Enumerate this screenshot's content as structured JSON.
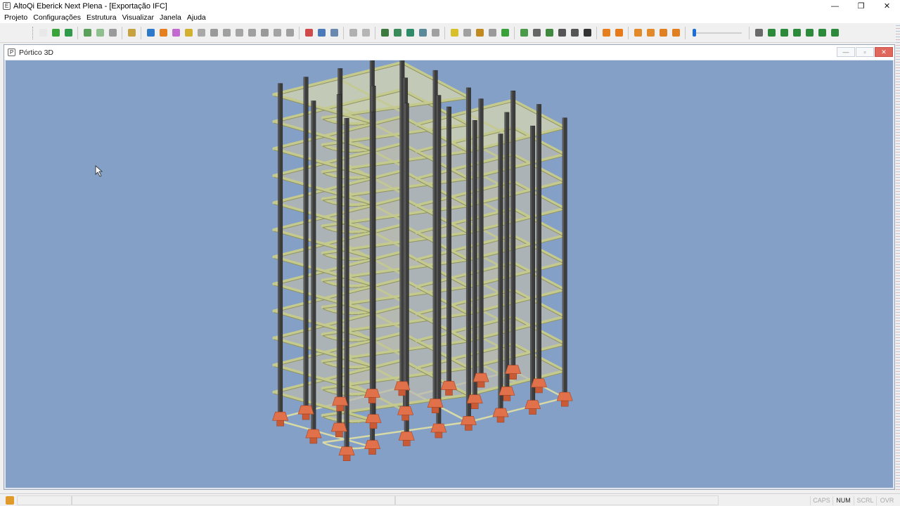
{
  "window": {
    "title": "AltoQi Eberick  Next Plena - [Exportação IFC]",
    "minimize": "—",
    "restore": "❐",
    "close": "✕"
  },
  "menu": [
    "Projeto",
    "Configurações",
    "Estrutura",
    "Visualizar",
    "Janela",
    "Ajuda"
  ],
  "toolbar": {
    "groups": [
      [
        {
          "icon": "new-doc-icon",
          "color": "#e8e8e8"
        },
        {
          "icon": "open-folder-icon",
          "color": "#3aa33a"
        },
        {
          "icon": "save-icon",
          "color": "#2f9a4a"
        }
      ],
      [
        {
          "icon": "check-edit-icon",
          "color": "#5aa05a"
        },
        {
          "icon": "verify-icon",
          "color": "#8fbf8f"
        },
        {
          "icon": "print-icon",
          "color": "#9a9a9a"
        }
      ],
      [
        {
          "icon": "tree-icon",
          "color": "#c9a240"
        }
      ],
      [
        {
          "icon": "beam-icon",
          "color": "#2d78c8"
        },
        {
          "icon": "column-icon",
          "color": "#e6801e"
        },
        {
          "icon": "slab-icon",
          "color": "#c26ad0"
        },
        {
          "icon": "foundation-icon",
          "color": "#d4b030"
        },
        {
          "icon": "wall-icon",
          "color": "#a8a8a8"
        },
        {
          "icon": "stair-icon",
          "color": "#9a9a9a"
        },
        {
          "icon": "ramp-icon",
          "color": "#a0a0a0"
        },
        {
          "icon": "reservoir-icon",
          "color": "#a5a5a5"
        },
        {
          "icon": "block-icon",
          "color": "#a0a0a0"
        },
        {
          "icon": "pile-icon",
          "color": "#999999"
        },
        {
          "icon": "rib-icon",
          "color": "#a3a3a3"
        },
        {
          "icon": "joist-icon",
          "color": "#a0a0a0"
        }
      ],
      [
        {
          "icon": "dimension-icon",
          "color": "#d14a4a"
        },
        {
          "icon": "grid-icon",
          "color": "#4a7ab8"
        },
        {
          "icon": "table-icon",
          "color": "#6a88b0"
        }
      ],
      [
        {
          "icon": "layers-icon",
          "color": "#b0b0b0"
        },
        {
          "icon": "layers-dropdown-icon",
          "color": "#b5b5b5"
        }
      ],
      [
        {
          "icon": "report-icon",
          "color": "#3d7a3d"
        },
        {
          "icon": "chart-icon",
          "color": "#3b8a5a"
        },
        {
          "icon": "sheet-icon",
          "color": "#2f8a6a"
        },
        {
          "icon": "list-icon",
          "color": "#5a8a9a"
        },
        {
          "icon": "comment-icon",
          "color": "#a0a0a0"
        }
      ],
      [
        {
          "icon": "lightning-icon",
          "color": "#d8c02a"
        },
        {
          "icon": "calculate-icon",
          "color": "#a0a0a0"
        },
        {
          "icon": "detail-icon",
          "color": "#c08a20"
        },
        {
          "icon": "drawing-icon",
          "color": "#9a9a9a"
        },
        {
          "icon": "ok-icon",
          "color": "#3aa03a"
        }
      ],
      [
        {
          "icon": "zoom-window-icon",
          "color": "#4a9a4a"
        },
        {
          "icon": "zoom-extents-icon",
          "color": "#666666"
        },
        {
          "icon": "zoom-icon",
          "color": "#3f8a3f"
        },
        {
          "icon": "rotate-icon",
          "color": "#555555"
        },
        {
          "icon": "pan-icon",
          "color": "#555555"
        },
        {
          "icon": "walk-icon",
          "color": "#333333"
        }
      ],
      [
        {
          "icon": "view-front-icon",
          "color": "#e6801e"
        },
        {
          "icon": "view-iso-icon",
          "color": "#e67a1a"
        }
      ],
      [
        {
          "icon": "cube-top-icon",
          "color": "#e28a2a"
        },
        {
          "icon": "cube-side-icon",
          "color": "#e28a2a"
        },
        {
          "icon": "cube-back-icon",
          "color": "#e08020"
        },
        {
          "icon": "cube-iso-icon",
          "color": "#e08020"
        }
      ]
    ],
    "end_icons": [
      {
        "icon": "properties-icon",
        "color": "#6a6a6a"
      },
      {
        "icon": "floor-up-icon",
        "color": "#2d8a3a"
      },
      {
        "icon": "floor-down-icon",
        "color": "#2d8a3a"
      },
      {
        "icon": "floor-show-icon",
        "color": "#2d8a3a"
      },
      {
        "icon": "floor-hide-icon",
        "color": "#2d8a3a"
      },
      {
        "icon": "floor-all-icon",
        "color": "#2d8a3a"
      },
      {
        "icon": "floor-extra-icon",
        "color": "#2d8a3a"
      }
    ],
    "transparency_level": 0
  },
  "child_window": {
    "title": "Pórtico 3D",
    "minimize": "—",
    "restore": "▫",
    "close": "✕"
  },
  "model_view": {
    "background": "#84a0c6",
    "slab_color": "#b9b9b0",
    "beam_color": "#c4c98e",
    "column_color": "#3d3d3d",
    "footing_color": "#e0714a",
    "floors": 12
  },
  "statusbar": {
    "indicators": [
      "CAPS",
      "NUM",
      "SCRL",
      "OVR"
    ],
    "active": "NUM"
  }
}
